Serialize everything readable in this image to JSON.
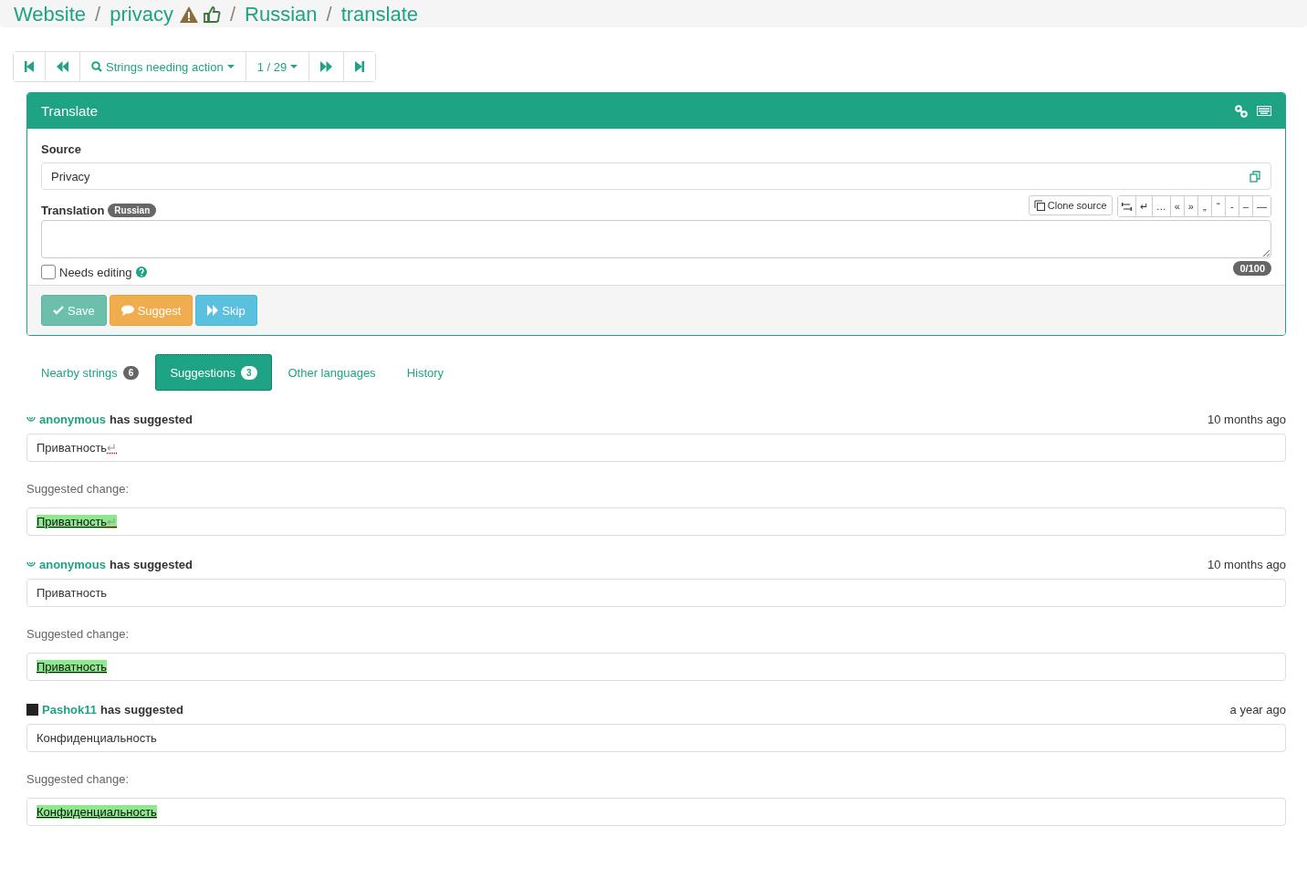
{
  "breadcrumb": {
    "separator": "/",
    "items": [
      "Website",
      "privacy",
      "Russian",
      "translate"
    ]
  },
  "navigation": {
    "filter": "Strings needing action",
    "position": "1 / 29"
  },
  "panel": {
    "title": "Translate",
    "source_label": "Source",
    "source": "Privacy",
    "translation_label": "Translation",
    "language": "Russian",
    "clone_button": "Clone source",
    "special_characters": [
      "↵",
      "…",
      "«",
      "»",
      "„",
      "“",
      "-",
      "–",
      "—"
    ],
    "counter": "0/100",
    "needs_editing": {
      "label": "Needs editing",
      "checked": false
    },
    "buttons": [
      {
        "kind": "save",
        "label": "Save"
      },
      {
        "kind": "suggest",
        "label": "Suggest"
      },
      {
        "kind": "skip",
        "label": "Skip"
      }
    ]
  },
  "tabs": [
    {
      "label": "Nearby strings",
      "count": "6",
      "selected": false
    },
    {
      "label": "Suggestions",
      "count": "3",
      "selected": true
    },
    {
      "label": "Other languages",
      "selected": false
    },
    {
      "label": "History",
      "selected": false
    }
  ],
  "suggestions": [
    {
      "kind": "icon",
      "user": "anonymous",
      "verb": "has suggested",
      "time": "10 months ago",
      "text": "Приватность",
      "newline_marker": "↵",
      "change_label": "Suggested change:",
      "change": "Приватность"
    },
    {
      "kind": "icon",
      "user": "anonymous",
      "verb": "has suggested",
      "time": "10 months ago",
      "text": "Приватность",
      "change_label": "Suggested change:",
      "change": "Приватность"
    },
    {
      "kind": "photo",
      "user": "Pashok11",
      "verb": "has suggested",
      "time": "a year ago",
      "text": "Конфиденциальность",
      "change_label": "Suggested change:",
      "change": "Конфиденциальность"
    }
  ]
}
